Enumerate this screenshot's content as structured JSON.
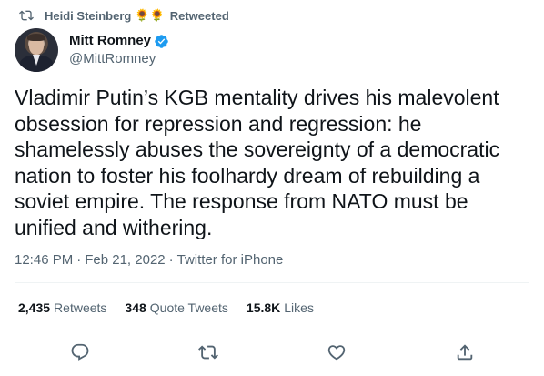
{
  "retweet_bar": {
    "icon": "retweet-icon",
    "retweeter_name": "Heidi Steinberg",
    "emoji": "🌻🌻",
    "label": "Retweeted"
  },
  "author": {
    "display_name": "Mitt Romney",
    "handle": "@MittRomney",
    "verified_icon": "verified-badge-icon"
  },
  "tweet": {
    "text": "Vladimir Putin’s KGB mentality drives his malevolent obsession for repression and regression: he shamelessly abuses the sovereignty of a democratic nation to foster his foolhardy dream of rebuilding a soviet empire. The response from NATO must be unified and withering."
  },
  "meta": {
    "time": "12:46 PM",
    "separator": "·",
    "date": "Feb 21, 2022",
    "source": "Twitter for iPhone"
  },
  "stats": {
    "retweets_count": "2,435",
    "retweets_label": "Retweets",
    "quotes_count": "348",
    "quotes_label": "Quote Tweets",
    "likes_count": "15.8K",
    "likes_label": "Likes"
  },
  "actions": {
    "reply": "reply-icon",
    "retweet": "retweet-icon",
    "like": "like-icon",
    "share": "share-icon"
  },
  "colors": {
    "text_primary": "#0f1419",
    "text_secondary": "#536471",
    "verified_blue": "#1d9bf0",
    "divider": "#eff3f4"
  }
}
